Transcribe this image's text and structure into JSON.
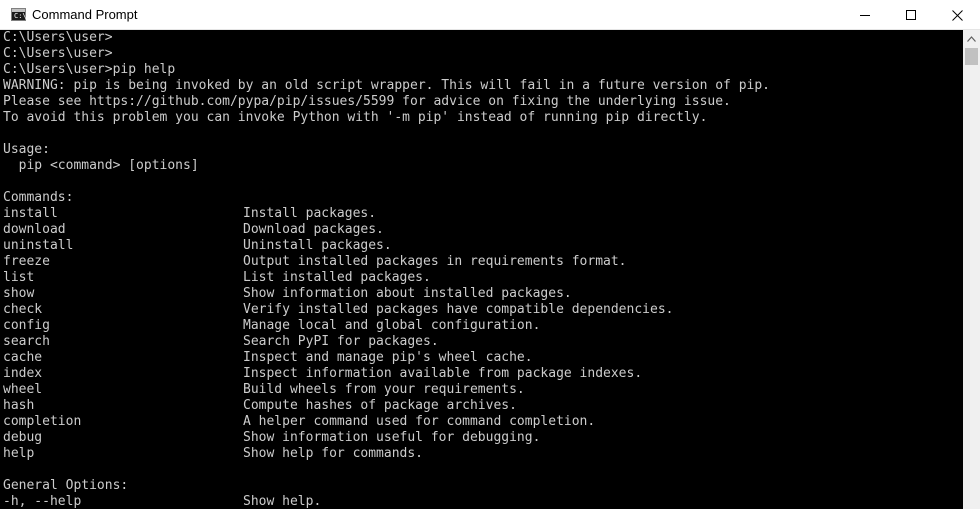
{
  "window": {
    "title": "Command Prompt",
    "icon_text": "C:\\",
    "icons": {
      "app": "command-prompt-icon",
      "minimize": "minimize-icon",
      "maximize": "maximize-icon",
      "close": "close-icon",
      "scroll_up": "chevron-up-icon"
    }
  },
  "console": {
    "prompt_lines": [
      "C:\\Users\\user>",
      "C:\\Users\\user>",
      "C:\\Users\\user>pip help"
    ],
    "warning_lines": [
      "WARNING: pip is being invoked by an old script wrapper. This will fail in a future version of pip.",
      "Please see https://github.com/pypa/pip/issues/5599 for advice on fixing the underlying issue.",
      "To avoid this problem you can invoke Python with '-m pip' instead of running pip directly."
    ],
    "usage_heading": "Usage:",
    "usage_line": "  pip <command> [options]",
    "commands_heading": "Commands:",
    "commands": [
      {
        "name": "install",
        "description": "Install packages."
      },
      {
        "name": "download",
        "description": "Download packages."
      },
      {
        "name": "uninstall",
        "description": "Uninstall packages."
      },
      {
        "name": "freeze",
        "description": "Output installed packages in requirements format."
      },
      {
        "name": "list",
        "description": "List installed packages."
      },
      {
        "name": "show",
        "description": "Show information about installed packages."
      },
      {
        "name": "check",
        "description": "Verify installed packages have compatible dependencies."
      },
      {
        "name": "config",
        "description": "Manage local and global configuration."
      },
      {
        "name": "search",
        "description": "Search PyPI for packages."
      },
      {
        "name": "cache",
        "description": "Inspect and manage pip's wheel cache."
      },
      {
        "name": "index",
        "description": "Inspect information available from package indexes."
      },
      {
        "name": "wheel",
        "description": "Build wheels from your requirements."
      },
      {
        "name": "hash",
        "description": "Compute hashes of package archives."
      },
      {
        "name": "completion",
        "description": "A helper command used for command completion."
      },
      {
        "name": "debug",
        "description": "Show information useful for debugging."
      },
      {
        "name": "help",
        "description": "Show help for commands."
      }
    ],
    "general_options_heading": "General Options:",
    "general_options": [
      {
        "name": "-h, --help",
        "description": "Show help."
      }
    ]
  },
  "colors": {
    "console_background": "#000000",
    "console_text": "#cccccc",
    "titlebar_background": "#ffffff",
    "scrollbar_track": "#f0f0f0",
    "scrollbar_thumb": "#c1c1c1"
  }
}
